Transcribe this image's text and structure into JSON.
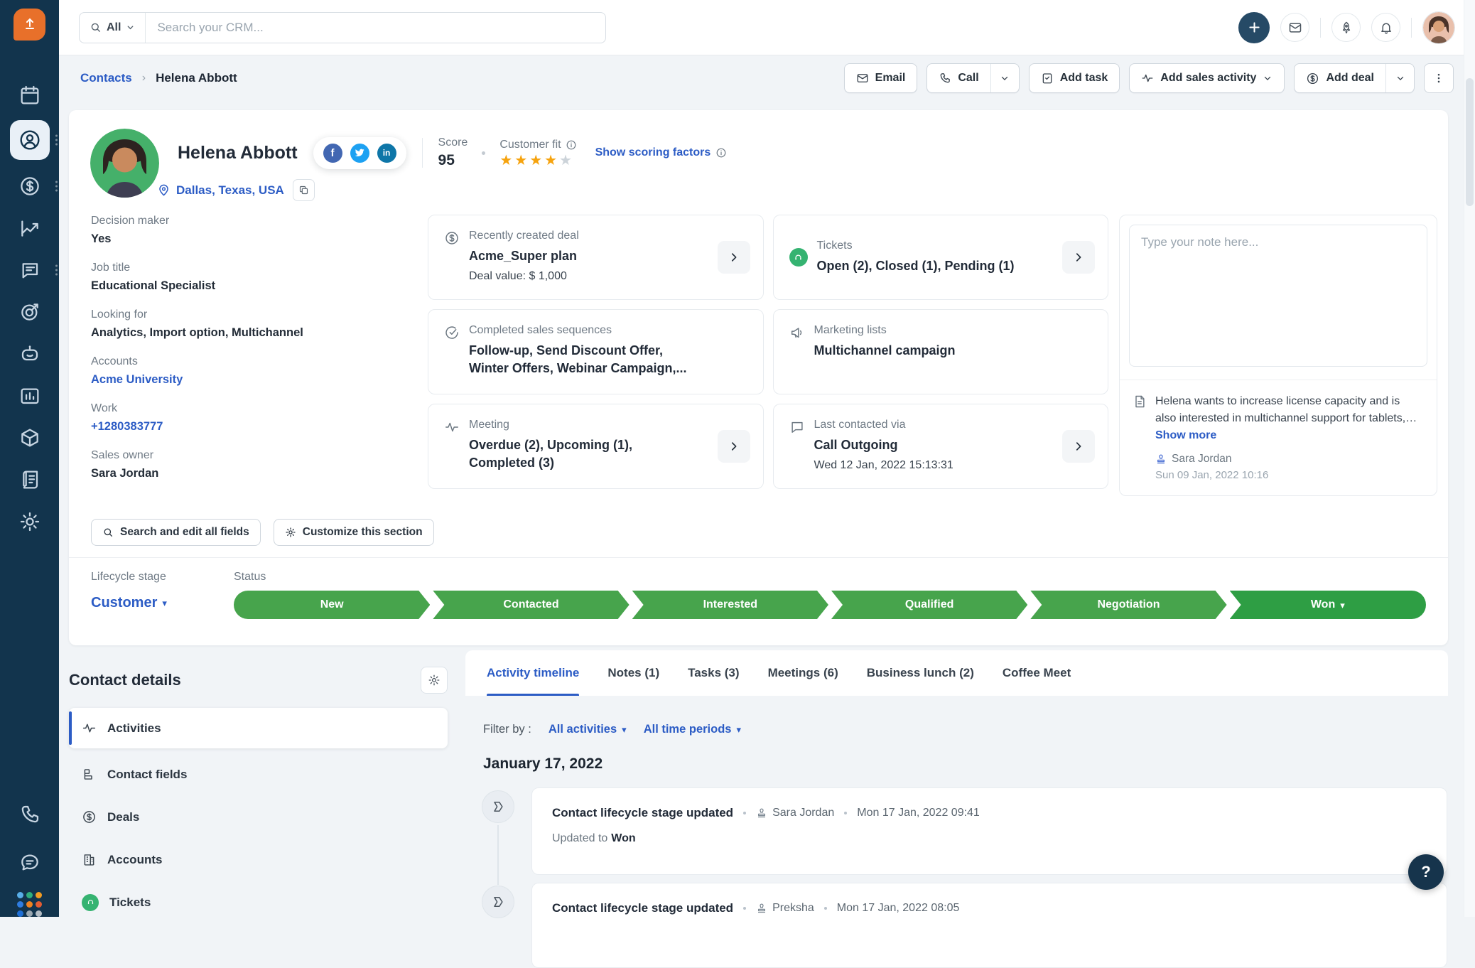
{
  "topbar": {
    "scope_label": "All",
    "search_placeholder": "Search your CRM..."
  },
  "breadcrumb": {
    "parent": "Contacts",
    "current": "Helena Abbott"
  },
  "action_bar": {
    "email": "Email",
    "call": "Call",
    "add_task": "Add task",
    "add_sales_activity": "Add sales activity",
    "add_deal": "Add deal"
  },
  "contact": {
    "name": "Helena Abbott",
    "location": "Dallas, Texas, USA",
    "score_label": "Score",
    "score_value": "95",
    "customer_fit_label": "Customer fit",
    "scoring_link": "Show scoring factors",
    "fields": [
      {
        "label": "Decision maker",
        "value": "Yes"
      },
      {
        "label": "Job title",
        "value": "Educational Specialist"
      },
      {
        "label": "Looking for",
        "value": "Analytics, Import option, Multichannel"
      },
      {
        "label": "Accounts",
        "value": "Acme University"
      },
      {
        "label": "Work",
        "value": "+1280383777"
      },
      {
        "label": "Sales owner",
        "value": "Sara Jordan"
      }
    ]
  },
  "summary_cards": [
    {
      "label": "Recently created deal",
      "title": "Acme_Super plan",
      "subtitle": "Deal value: $ 1,000"
    },
    {
      "label": "Tickets",
      "title": "Open (2), Closed (1), Pending (1)"
    },
    {
      "label": "Completed sales sequences",
      "title": "Follow-up, Send Discount Offer, Winter Offers, Webinar Campaign,..."
    },
    {
      "label": "Marketing lists",
      "title": "Multichannel campaign"
    },
    {
      "label": "Meeting",
      "title": "Overdue (2), Upcoming (1), Completed (3)"
    },
    {
      "label": "Last contacted via",
      "title": "Call Outgoing",
      "subtitle": "Wed 12 Jan, 2022 15:13:31"
    }
  ],
  "notes": {
    "placeholder": "Type your note here...",
    "note_text": "Helena wants to increase license capacity and is also interested in multichannel support for tablets, iOS, an...",
    "show_more": "Show more",
    "author": "Sara Jordan",
    "timestamp": "Sun 09 Jan, 2022 10:16"
  },
  "section_actions": {
    "search_fields": "Search and edit all fields",
    "customize": "Customize this section"
  },
  "lifecycle": {
    "stage_label": "Lifecycle stage",
    "stage_value": "Customer",
    "status_label": "Status",
    "stages": [
      "New",
      "Contacted",
      "Interested",
      "Qualified",
      "Negotiation",
      "Won"
    ]
  },
  "contact_details": {
    "title": "Contact details",
    "items": [
      "Activities",
      "Contact fields",
      "Deals",
      "Accounts",
      "Tickets"
    ]
  },
  "tabs": [
    "Activity timeline",
    "Notes (1)",
    "Tasks (3)",
    "Meetings (6)",
    "Business lunch (2)",
    "Coffee Meet"
  ],
  "timeline": {
    "filter_label": "Filter by :",
    "filter_activities": "All activities",
    "filter_periods": "All time periods",
    "date_header": "January 17, 2022",
    "items": [
      {
        "title": "Contact lifecycle stage updated",
        "author": "Sara Jordan",
        "time": "Mon 17 Jan, 2022 09:41",
        "detail_label": "Updated to",
        "detail_value": "Won"
      },
      {
        "title": "Contact lifecycle stage updated",
        "author": "Preksha",
        "time": "Mon 17 Jan, 2022 08:05"
      }
    ]
  },
  "help": {
    "label": "?"
  }
}
